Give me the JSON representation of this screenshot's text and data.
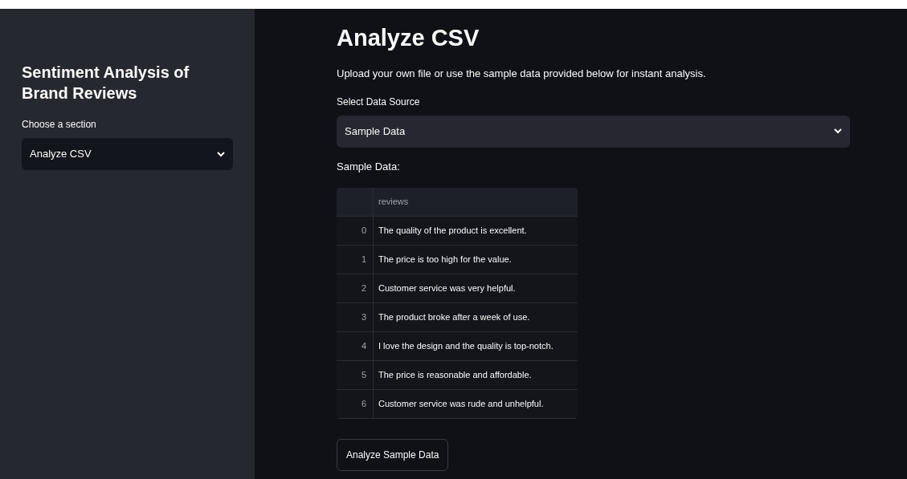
{
  "sidebar": {
    "title": "Sentiment Analysis of Brand Reviews",
    "select_label": "Choose a section",
    "select_value": "Analyze CSV"
  },
  "main": {
    "title": "Analyze CSV",
    "description": "Upload your own file or use the sample data provided below for instant analysis.",
    "source_label": "Select Data Source",
    "source_value": "Sample Data",
    "table_caption": "Sample Data:",
    "table": {
      "columns": [
        "reviews"
      ],
      "rows": [
        {
          "index": "0",
          "review": "The quality of the product is excellent."
        },
        {
          "index": "1",
          "review": "The price is too high for the value."
        },
        {
          "index": "2",
          "review": "Customer service was very helpful."
        },
        {
          "index": "3",
          "review": "The product broke after a week of use."
        },
        {
          "index": "4",
          "review": "I love the design and the quality is top-notch."
        },
        {
          "index": "5",
          "review": "The price is reasonable and affordable."
        },
        {
          "index": "6",
          "review": "Customer service was rude and unhelpful."
        }
      ]
    },
    "button": "Analyze Sample Data"
  }
}
